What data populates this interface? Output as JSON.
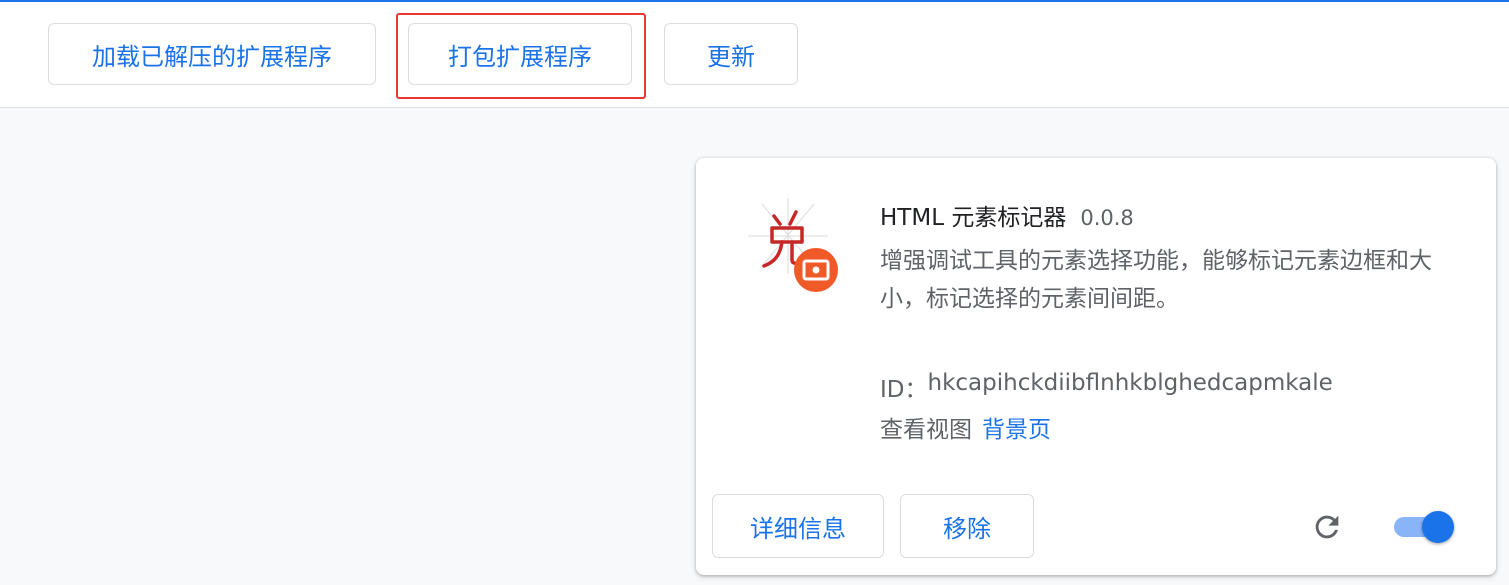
{
  "toolbar": {
    "load_unpacked_label": "加载已解压的扩展程序",
    "pack_extension_label": "打包扩展程序",
    "update_label": "更新"
  },
  "extension": {
    "name": "HTML 元素标记器",
    "version": "0.0.8",
    "description": "增强调试工具的元素选择功能，能够标记元素边框和大小，标记选择的元素间间距。",
    "id_label": "ID：",
    "id_value": "hkcapihckdiibflnhkblghedcapmkale",
    "views_label": "查看视图",
    "background_page_link": "背景页",
    "details_button": "详细信息",
    "remove_button": "移除",
    "enabled": true,
    "icon": "extension-logo-icon"
  },
  "icons": {
    "reload": "reload-icon"
  },
  "colors": {
    "accent": "#1a73e8",
    "highlight_border": "#e53935",
    "toggle_track": "#8ab4f8"
  }
}
